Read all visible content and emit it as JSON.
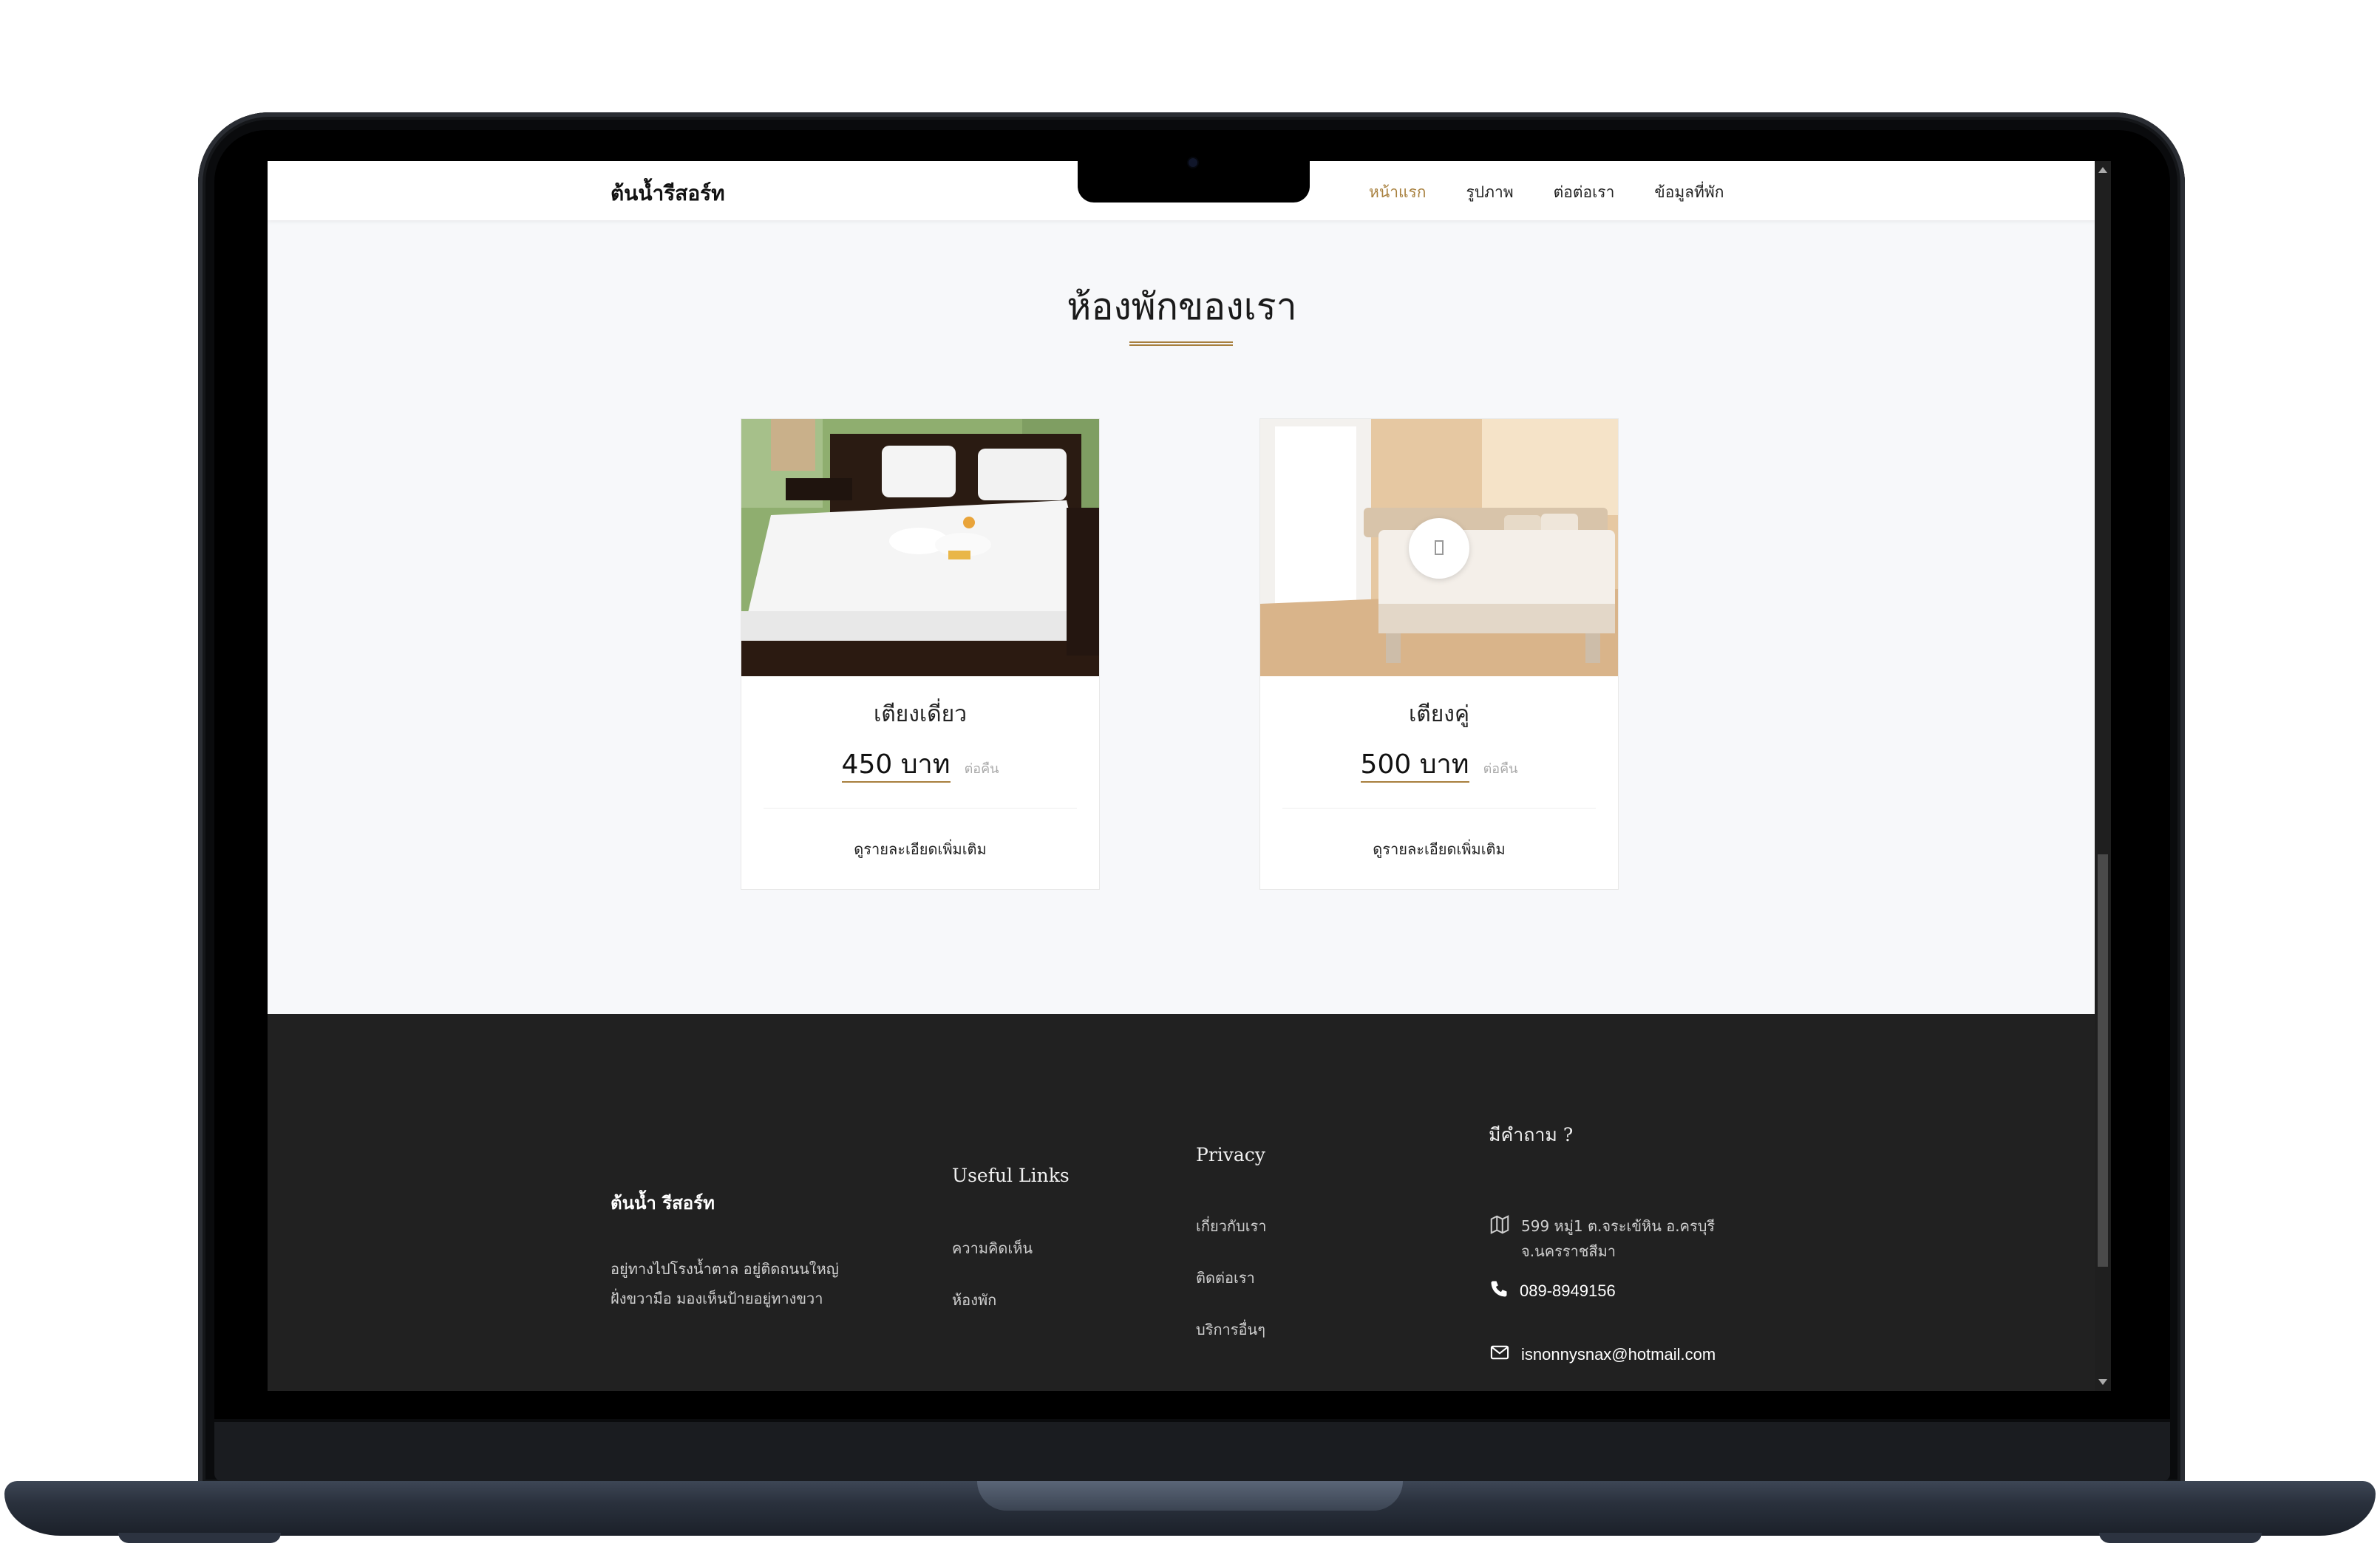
{
  "navbar": {
    "brand": "ต้นน้ำรีสอร์ท",
    "links": [
      "หน้าแรก",
      "รูปภาพ",
      "ต่อต่อเรา",
      "ข้อมูลที่พัก"
    ],
    "active_color": "#a8803e"
  },
  "rooms_section": {
    "title": "ห้องพักของเรา",
    "rooms": [
      {
        "name": "เตียงเดี่ยว",
        "price": "450 บาท",
        "per": "ต่อคืน",
        "more": "ดูรายละเอียดเพิ่มเติม"
      },
      {
        "name": "เตียงคู่",
        "price": "500 บาท",
        "per": "ต่อคืน",
        "more": "ดูรายละเอียดเพิ่มเติม"
      }
    ]
  },
  "footer": {
    "brand": "ต้นน้ำ รีสอร์ท",
    "description_line1": "อยู่ทางไปโรงน้ำตาล อยู่ติดถนนใหญ่",
    "description_line2": "ฝั่งขวามือ มองเห็นป้ายอยู่ทางขวา",
    "useful_links_title": "Useful Links",
    "useful_links": [
      "ความคิดเห็น",
      "ห้องพัก"
    ],
    "privacy_title": "Privacy",
    "privacy_links": [
      "เกี่ยวกับเรา",
      "ติดต่อเรา",
      "บริการอื่นๆ"
    ],
    "contact_title": "มีคำถาม ?",
    "address_line1": "599 หมู่1 ต.จระเข้หิน อ.ครบุรี",
    "address_line2": "จ.นครราชสีมา",
    "phone": "089-8949156",
    "email": "isnonnysnax@hotmail.com"
  }
}
